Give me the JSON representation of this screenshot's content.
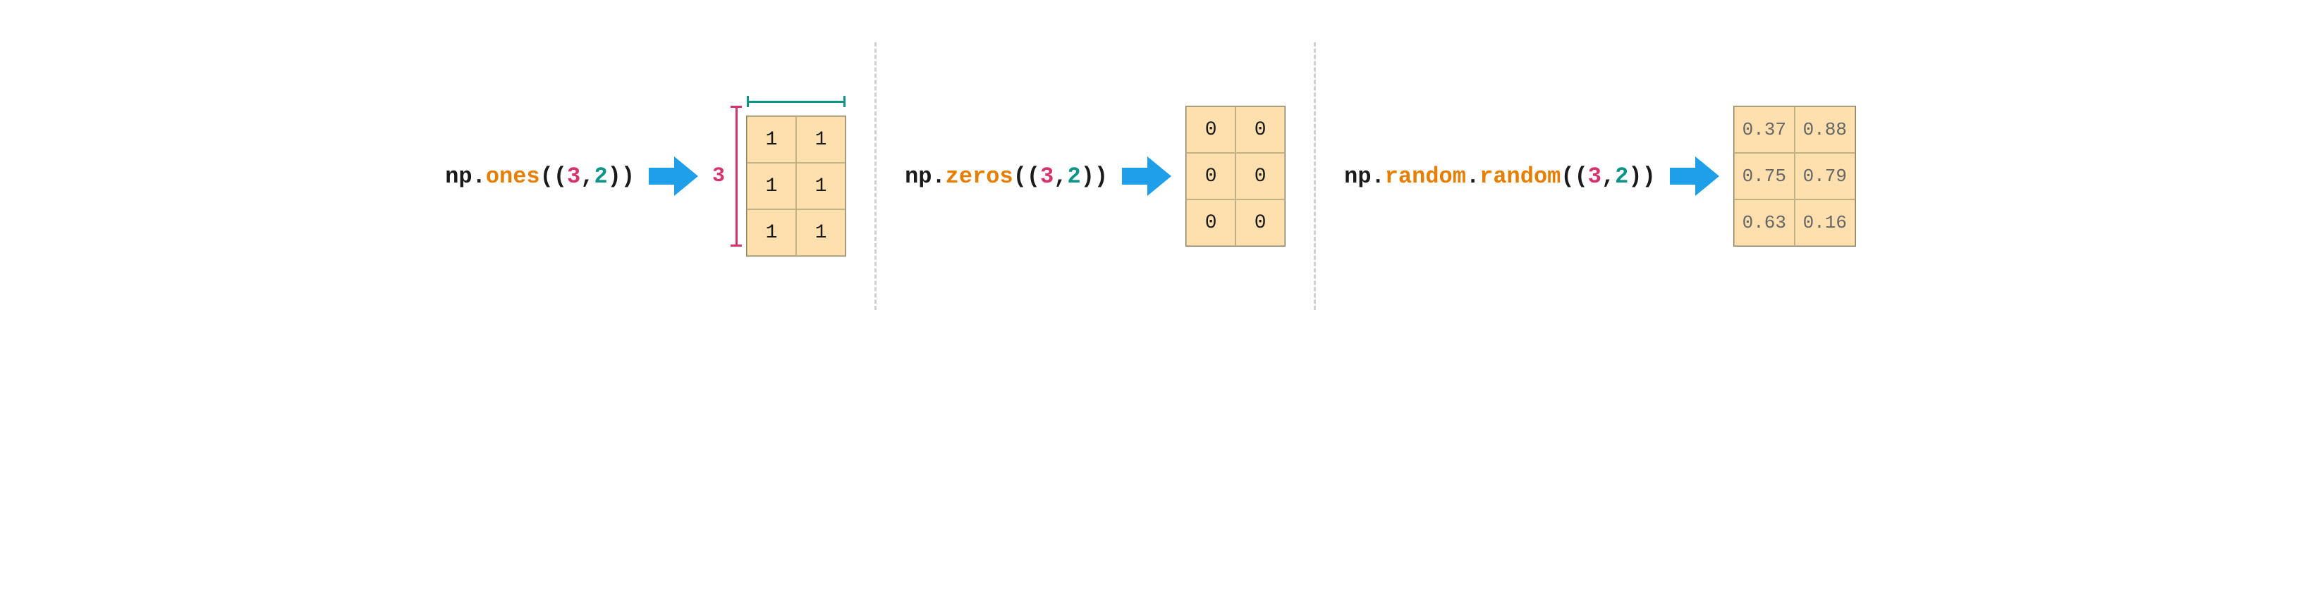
{
  "panel1": {
    "code": {
      "np": "np",
      "dot1": ".",
      "func": "ones",
      "open": "((",
      "rows": "3",
      "comma": ",",
      "cols": "2",
      "close": "))"
    },
    "rowLabel": "3",
    "matrix": [
      [
        "1",
        "1"
      ],
      [
        "1",
        "1"
      ],
      [
        "1",
        "1"
      ]
    ]
  },
  "panel2": {
    "code": {
      "np": "np",
      "dot1": ".",
      "func": "zeros",
      "open": "((",
      "rows": "3",
      "comma": ",",
      "cols": "2",
      "close": "))"
    },
    "matrix": [
      [
        "0",
        "0"
      ],
      [
        "0",
        "0"
      ],
      [
        "0",
        "0"
      ]
    ]
  },
  "panel3": {
    "code": {
      "np": "np",
      "dot1": ".",
      "mod": "random",
      "dot2": ".",
      "func": "random",
      "open": "((",
      "rows": "3",
      "comma": ",",
      "cols": "2",
      "close": "))"
    },
    "matrix": [
      [
        "0.37",
        "0.88"
      ],
      [
        "0.75",
        "0.79"
      ],
      [
        "0.63",
        "0.16"
      ]
    ]
  },
  "colors": {
    "arrow": "#1e9fe8",
    "cellBg": "#fedfae",
    "pink": "#d6336c",
    "teal": "#0d9488",
    "orange": "#e67e00"
  }
}
